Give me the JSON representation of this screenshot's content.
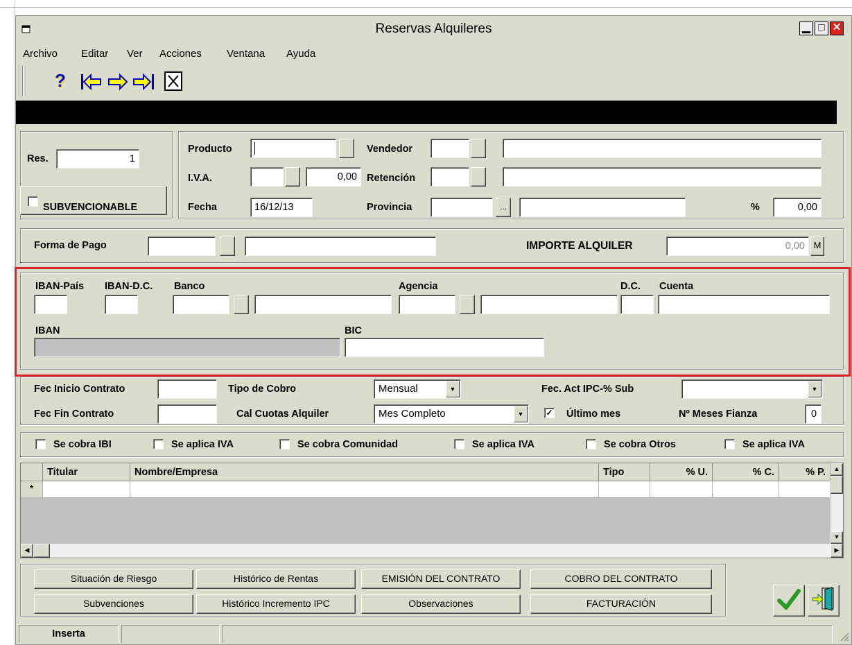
{
  "window": {
    "title": "Reservas Alquileres"
  },
  "menu": [
    "Archivo",
    "Editar",
    "Ver",
    "Acciones",
    "Ventana",
    "Ayuda"
  ],
  "toolbar": {
    "help": "?",
    "icons": [
      "help-icon",
      "first-record-icon",
      "next-record-icon",
      "last-record-icon",
      "close-record-icon"
    ]
  },
  "header": {
    "res_label": "Res.",
    "res_value": "1",
    "subvencionable_label": "SUBVENCIONABLE",
    "producto_label": "Producto",
    "producto_value": "",
    "vendedor_label": "Vendedor",
    "iva_label": "I.V.A.",
    "iva_value": "0,00",
    "retencion_label": "Retención",
    "fecha_label": "Fecha",
    "fecha_value": "16/12/13",
    "provincia_label": "Provincia",
    "provincia_btn": "...",
    "percent_label": "%",
    "percent_value": "0,00"
  },
  "pago": {
    "forma_label": "Forma de Pago",
    "importe_label": "IMPORTE ALQUILER",
    "importe_value": "0,00",
    "m_btn": "M"
  },
  "bank": {
    "iban_pais": "IBAN-País",
    "iban_dc": "IBAN-D.C.",
    "banco": "Banco",
    "agencia": "Agencia",
    "dc": "D.C.",
    "cuenta": "Cuenta",
    "iban": "IBAN",
    "bic": "BIC"
  },
  "contract": {
    "fec_inicio": "Fec Inicio Contrato",
    "fec_fin": "Fec Fin Contrato",
    "tipo_cobro_label": "Tipo de Cobro",
    "tipo_cobro_value": "Mensual",
    "cal_cuotas_label": "Cal Cuotas Alquiler",
    "cal_cuotas_value": "Mes Completo",
    "fec_act_ipc_label": "Fec. Act IPC-% Sub",
    "fec_act_ipc_value": "",
    "ultimo_mes_label": "Último mes",
    "ultimo_mes_checked": true,
    "meses_fianza_label": "Nº Meses Fianza",
    "meses_fianza_value": "0"
  },
  "checks": [
    "Se cobra IBI",
    "Se aplica IVA",
    "Se cobra Comunidad",
    "Se aplica IVA",
    "Se cobra Otros",
    "Se aplica IVA"
  ],
  "grid": {
    "columns": [
      "Titular",
      "Nombre/Empresa",
      "Tipo",
      "% U.",
      "% C.",
      "% P."
    ],
    "new_row_marker": "*"
  },
  "buttons": {
    "situacion": "Situación de Riesgo",
    "historico_rentas": "Histórico de Rentas",
    "emision": "EMISIÓN DEL CONTRATO",
    "cobro": "COBRO DEL CONTRATO",
    "subvenciones": "Subvenciones",
    "historico_ipc": "Histórico Incremento IPC",
    "observaciones": "Observaciones",
    "facturacion": "FACTURACIÓN"
  },
  "status": {
    "mode": "Inserta"
  },
  "colors": {
    "window_bg": "#dcdccc",
    "highlight_border": "#e0232e",
    "ok_green": "#2a9a2a",
    "nav_blue": "#0000c8",
    "nav_yellow": "#ffff00"
  }
}
